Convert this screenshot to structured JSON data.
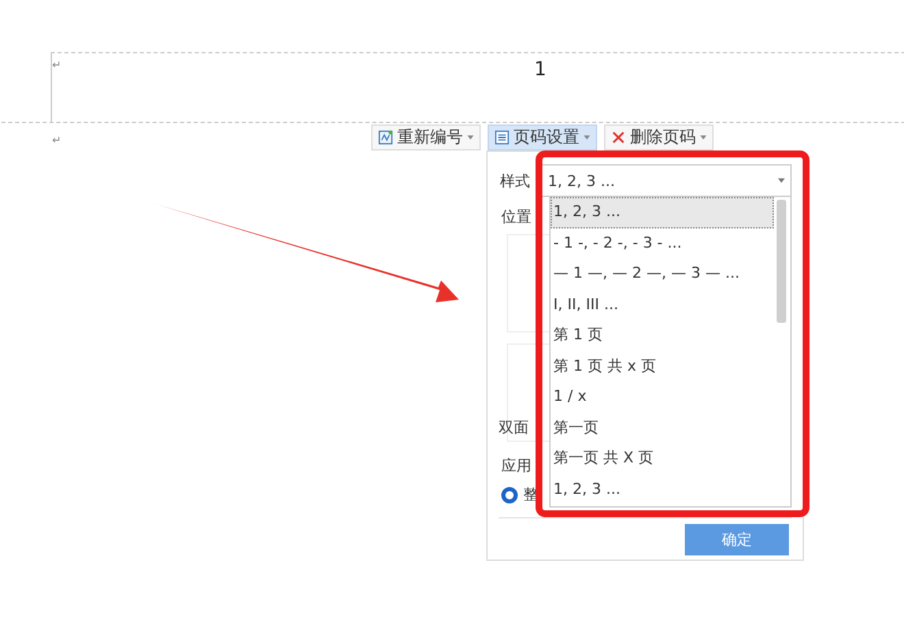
{
  "header": {
    "page_number": "1",
    "return_marks": [
      "↵",
      "↵"
    ]
  },
  "toolbar": [
    {
      "label": "重新编号",
      "kind": "renumber",
      "selected": false
    },
    {
      "label": "页码设置",
      "kind": "settings",
      "selected": true
    },
    {
      "label": "删除页码",
      "kind": "delete",
      "selected": false
    }
  ],
  "panel": {
    "style_label": "样式",
    "style_value": "1, 2, 3 ...",
    "position_label": "位置",
    "double_label": "双面",
    "apply_label": "应用",
    "radio": {
      "label": "整",
      "selected": true
    },
    "ok": "确定"
  },
  "dropdown": [
    {
      "label": "1, 2, 3 ...",
      "selected": true
    },
    {
      "label": "- 1 -, - 2 -, - 3 - ...",
      "selected": false
    },
    {
      "label": "— 1 —, — 2 —, — 3 — ...",
      "selected": false
    },
    {
      "label": "I, II, III ...",
      "selected": false
    },
    {
      "label": "第 1 页",
      "selected": false
    },
    {
      "label": "第 1 页 共 x 页",
      "selected": false
    },
    {
      "label": "1 / x",
      "selected": false
    },
    {
      "label": "第一页",
      "selected": false
    },
    {
      "label": "第一页 共 X 页",
      "selected": false
    },
    {
      "label": "1, 2, 3 ...",
      "selected": false
    }
  ]
}
